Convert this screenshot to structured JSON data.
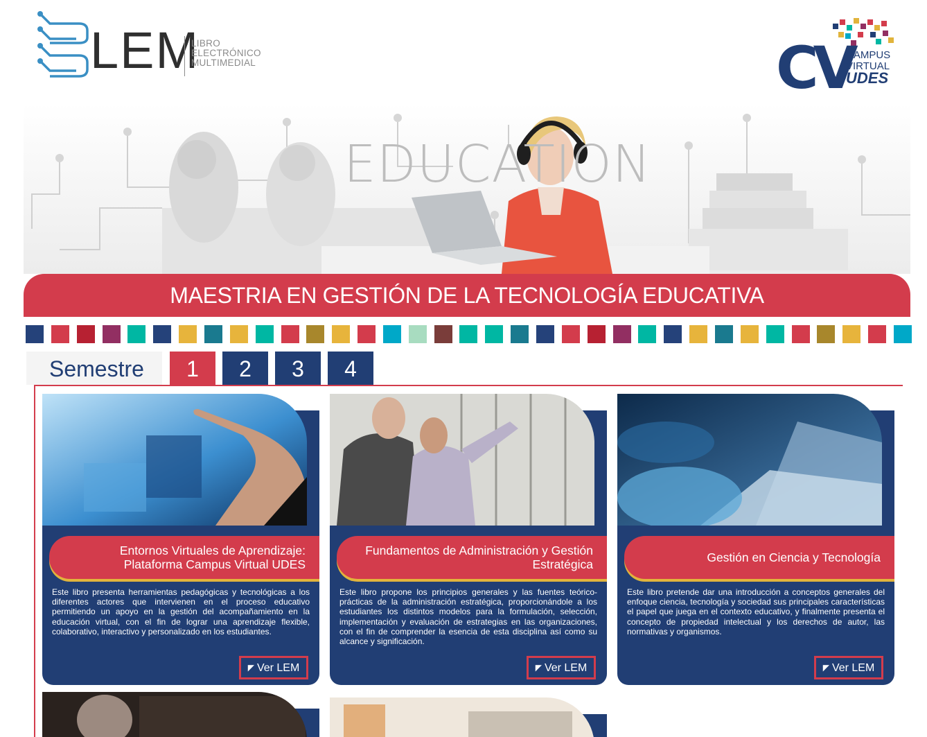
{
  "header": {
    "lem_logo": {
      "word": "LEM",
      "line1": "LIBRO",
      "line2": "ELECTRÓNICO",
      "line3": "MULTIMEDIAL"
    },
    "cv_logo": {
      "letters": "CV",
      "line1": "CAMPUS",
      "line2": "VIRTUAL",
      "line3": "UDES"
    }
  },
  "banner": {
    "watermark": "EDUCATION"
  },
  "title": "MAESTRIA EN GESTIÓN DE LA TECNOLOGÍA EDUCATIVA",
  "color_strip": [
    "#25427a",
    "#d33c4c",
    "#b72132",
    "#922f62",
    "#00b7a3",
    "#25427a",
    "#e7b43c",
    "#1a7a8f",
    "#e7b43c",
    "#00b7a3",
    "#d33c4c",
    "#a8872c",
    "#e7b43c",
    "#d33c4c",
    "#00a8c8",
    "#a8dcc0",
    "#7a3d3a",
    "#00b7a3",
    "#00b7a3",
    "#1a7a8f",
    "#25427a",
    "#d33c4c",
    "#b72132",
    "#922f62",
    "#00b7a3",
    "#25427a",
    "#e7b43c",
    "#1a7a8f",
    "#e7b43c",
    "#00b7a3",
    "#d33c4c",
    "#a8872c",
    "#e7b43c",
    "#d33c4c",
    "#00a8c8"
  ],
  "semester": {
    "label": "Semestre",
    "tabs": [
      "1",
      "2",
      "3",
      "4"
    ],
    "active": "1"
  },
  "colors": {
    "brand_red": "#d33c4c",
    "brand_navy": "#213e74",
    "accent_gold": "#e1b43c"
  },
  "cards": [
    {
      "title": "Entornos Virtuales de Aprendizaje: Plataforma Campus Virtual UDES",
      "description": "Este libro presenta herramientas pedagógicas y tecnológicas a los diferentes actores que intervienen en el proceso educativo permitiendo un apoyo en la gestión del acompañamiento en la educación virtual, con el fin de lograr una aprendizaje flexible, colaborativo, interactivo y personalizado en los estudiantes.",
      "button": "Ver LEM"
    },
    {
      "title": "Fundamentos de Administración y Gestión Estratégica",
      "description": "Este libro propone los principios generales y las fuentes teórico-prácticas de la administración estratégica, proporcionándole a los estudiantes los distintos modelos para la formulación, selección, implementación y evaluación de estrategias en las organizaciones, con el fin de comprender la esencia de esta disciplina así como su alcance y significación.",
      "button": "Ver LEM"
    },
    {
      "title": "Gestión en Ciencia y Tecnología",
      "description": "Este libro pretende dar una introducción a conceptos generales del enfoque ciencia, tecnología y sociedad sus principales características el papel que juega en el contexto educativo, y finalmente presenta el concepto de propiedad intelectual y los derechos de autor, las normativas y organismos.",
      "button": "Ver LEM"
    }
  ]
}
